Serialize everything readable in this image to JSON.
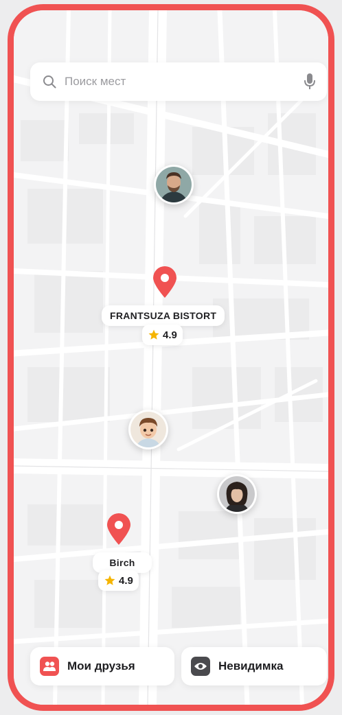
{
  "search": {
    "placeholder": "Поиск мест",
    "icon": "search-icon",
    "mic_icon": "microphone-icon"
  },
  "map": {
    "places": [
      {
        "name": "FRANTSUZA BISTORT",
        "rating": "4.9"
      },
      {
        "name": "Birch",
        "rating": "4.9"
      }
    ],
    "friends": [
      {
        "avatar": "man-beard-avatar"
      },
      {
        "avatar": "cartoon-boy-avatar"
      },
      {
        "avatar": "curly-hair-man-avatar"
      }
    ]
  },
  "bottom": {
    "friends_label": "Мои друзья",
    "invisible_label": "Невидимка"
  },
  "colors": {
    "accent": "#f05252",
    "star": "#f5b400",
    "frame": "#f05252"
  }
}
